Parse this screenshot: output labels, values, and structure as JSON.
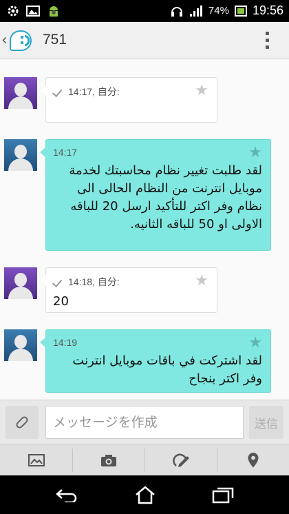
{
  "status_bar": {
    "battery_percent": "74%",
    "time": "19:56",
    "icons": [
      "gallery-icon",
      "android-icon",
      "headset-icon",
      "signal-icon",
      "battery-icon"
    ]
  },
  "header": {
    "title": "751"
  },
  "messages": [
    {
      "direction": "out",
      "time": "14:17, 自分:",
      "text": ""
    },
    {
      "direction": "in",
      "time": "14:17",
      "text": "لقد طلبت تغيير نظام محاسبتك لخدمة موبايل انترنت من النظام الحالى الى نظام وفر اكتر للتأكيد ارسل 20 للباقه الاولى او 50 للباقه الثانيه."
    },
    {
      "direction": "out",
      "time": "14:18, 自分:",
      "text": "20"
    },
    {
      "direction": "in",
      "time": "14:19",
      "text": "لقد اشتركت في  باقات موبايل انترنت وفر اكتر بنجاح"
    }
  ],
  "composer": {
    "placeholder": "メッセージを作成",
    "send_label": "送信"
  },
  "colors": {
    "incoming_bubble": "#80e8e0",
    "outgoing_bubble": "#ffffff",
    "app_accent": "#2aa6c8"
  }
}
